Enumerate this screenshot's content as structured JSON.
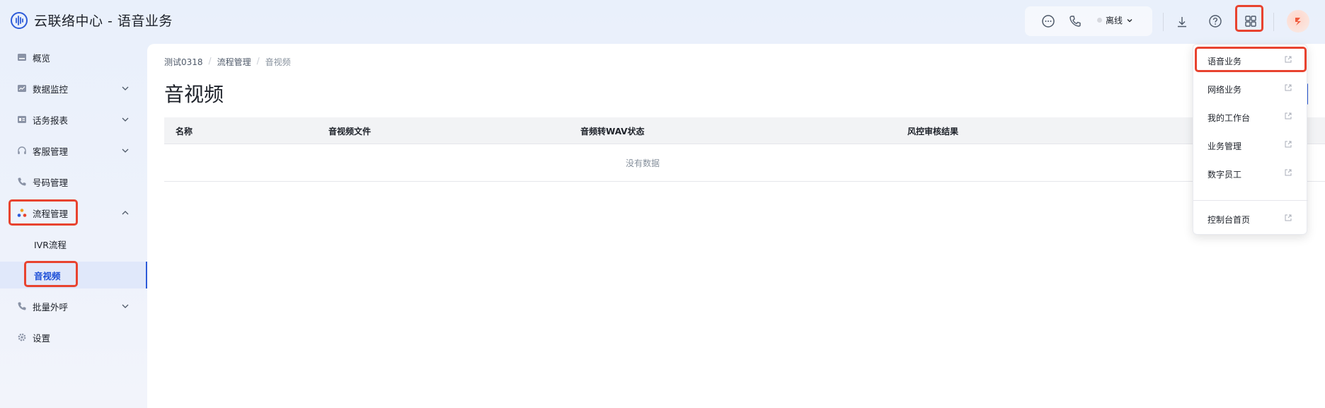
{
  "app": {
    "title": "云联络中心 - 语音业务"
  },
  "header": {
    "status_label": "离线",
    "icons": [
      "chat-icon",
      "phone-icon",
      "download-icon",
      "help-icon",
      "apps-grid-icon",
      "avatar"
    ]
  },
  "sidebar": {
    "items": [
      {
        "label": "概览",
        "icon": "overview-icon"
      },
      {
        "label": "数据监控",
        "icon": "monitor-icon"
      },
      {
        "label": "话务报表",
        "icon": "report-icon"
      },
      {
        "label": "客服管理",
        "icon": "headset-icon"
      },
      {
        "label": "号码管理",
        "icon": "phone-icon"
      },
      {
        "label": "流程管理",
        "icon": "flow-icon"
      },
      {
        "label": "批量外呼",
        "icon": "outbound-call-icon"
      },
      {
        "label": "设置",
        "icon": "gear-icon"
      }
    ],
    "sub_items": [
      {
        "label": "IVR流程"
      },
      {
        "label": "音视频"
      }
    ]
  },
  "breadcrumb": {
    "root": "测试0318",
    "parent": "流程管理",
    "current": "音视频"
  },
  "page": {
    "title": "音视频"
  },
  "table": {
    "columns": [
      "名称",
      "音视频文件",
      "音频转WAV状态",
      "风控审核结果"
    ],
    "empty_text": "没有数据"
  },
  "dropdown": {
    "items": [
      "语音业务",
      "网络业务",
      "我的工作台",
      "业务管理",
      "数字员工"
    ],
    "footer_item": "控制台首页"
  },
  "colors": {
    "accent": "#2d5bd9",
    "highlight": "#e8432f",
    "active_bg": "#e0e8fa"
  }
}
